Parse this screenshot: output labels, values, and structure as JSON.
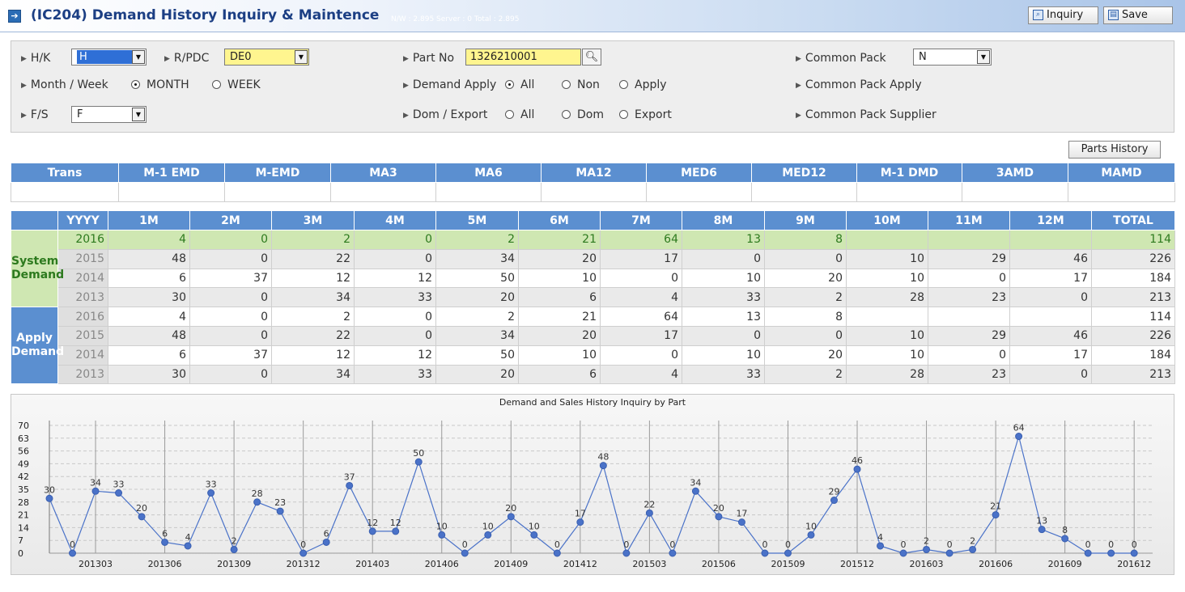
{
  "header": {
    "title": "(IC204) Demand History Inquiry & Maintence",
    "stats": "N/W : 2.895   Server : 0   Total : 2.895",
    "inquiry_label": "Inquiry",
    "save_label": "Save"
  },
  "filters": {
    "hk_label": "H/K",
    "hk_value": "H",
    "rpdc_label": "R/PDC",
    "rpdc_value": "DE0",
    "partno_label": "Part No",
    "partno_value": "1326210001",
    "common_pack_label": "Common Pack",
    "common_pack_value": "N",
    "month_week_label": "Month / Week",
    "month_option": "MONTH",
    "week_option": "WEEK",
    "month_week_selected": "MONTH",
    "demand_apply_label": "Demand Apply",
    "demand_apply_options": [
      "All",
      "Non",
      "Apply"
    ],
    "demand_apply_selected": "All",
    "common_pack_apply_label": "Common Pack Apply",
    "fs_label": "F/S",
    "fs_value": "F",
    "dom_export_label": "Dom / Export",
    "dom_export_options": [
      "All",
      "Dom",
      "Export"
    ],
    "dom_export_selected": "",
    "common_pack_supplier_label": "Common Pack Supplier"
  },
  "parts_history_label": "Parts History",
  "trans_table": {
    "headers": [
      "Trans",
      "M-1 EMD",
      "M-EMD",
      "MA3",
      "MA6",
      "MA12",
      "MED6",
      "MED12",
      "M-1 DMD",
      "3AMD",
      "MAMD"
    ],
    "row": [
      "",
      "",
      "",
      "",
      "",
      "",
      "",
      "",
      "",
      "",
      ""
    ]
  },
  "history_table": {
    "headers": [
      "YYYY",
      "1M",
      "2M",
      "3M",
      "4M",
      "5M",
      "6M",
      "7M",
      "8M",
      "9M",
      "10M",
      "11M",
      "12M",
      "TOTAL"
    ],
    "groups": [
      {
        "label_line1": "System",
        "label_line2": "Demand",
        "rows": [
          {
            "year": "2016",
            "values": [
              "4",
              "0",
              "2",
              "0",
              "2",
              "21",
              "64",
              "13",
              "8",
              "",
              "",
              ""
            ],
            "total": "114"
          },
          {
            "year": "2015",
            "values": [
              "48",
              "0",
              "22",
              "0",
              "34",
              "20",
              "17",
              "0",
              "0",
              "10",
              "29",
              "46"
            ],
            "total": "226"
          },
          {
            "year": "2014",
            "values": [
              "6",
              "37",
              "12",
              "12",
              "50",
              "10",
              "0",
              "10",
              "20",
              "10",
              "0",
              "17"
            ],
            "total": "184"
          },
          {
            "year": "2013",
            "values": [
              "30",
              "0",
              "34",
              "33",
              "20",
              "6",
              "4",
              "33",
              "2",
              "28",
              "23",
              "0"
            ],
            "total": "213"
          }
        ]
      },
      {
        "label_line1": "Apply",
        "label_line2": "Demand",
        "rows": [
          {
            "year": "2016",
            "values": [
              "4",
              "0",
              "2",
              "0",
              "2",
              "21",
              "64",
              "13",
              "8",
              "",
              "",
              ""
            ],
            "total": "114"
          },
          {
            "year": "2015",
            "values": [
              "48",
              "0",
              "22",
              "0",
              "34",
              "20",
              "17",
              "0",
              "0",
              "10",
              "29",
              "46"
            ],
            "total": "226"
          },
          {
            "year": "2014",
            "values": [
              "6",
              "37",
              "12",
              "12",
              "50",
              "10",
              "0",
              "10",
              "20",
              "10",
              "0",
              "17"
            ],
            "total": "184"
          },
          {
            "year": "2013",
            "values": [
              "30",
              "0",
              "34",
              "33",
              "20",
              "6",
              "4",
              "33",
              "2",
              "28",
              "23",
              "0"
            ],
            "total": "213"
          }
        ]
      }
    ]
  },
  "chart_data": {
    "type": "line",
    "title": "Demand and Sales History Inquiry by Part",
    "xlabel": "",
    "ylabel": "",
    "ylim": [
      0,
      70
    ],
    "yticks": [
      0,
      7,
      14,
      21,
      28,
      35,
      42,
      49,
      56,
      63,
      70
    ],
    "grid": true,
    "x": [
      "201301",
      "201302",
      "201303",
      "201304",
      "201305",
      "201306",
      "201307",
      "201308",
      "201309",
      "201310",
      "201311",
      "201312",
      "201401",
      "201402",
      "201403",
      "201404",
      "201405",
      "201406",
      "201407",
      "201408",
      "201409",
      "201410",
      "201411",
      "201412",
      "201501",
      "201502",
      "201503",
      "201504",
      "201505",
      "201506",
      "201507",
      "201508",
      "201509",
      "201510",
      "201511",
      "201512",
      "201601",
      "201602",
      "201603",
      "201604",
      "201605",
      "201606",
      "201607",
      "201608",
      "201609",
      "201610",
      "201611",
      "201612"
    ],
    "x_tick_labels": [
      "201303",
      "201306",
      "201309",
      "201312",
      "201403",
      "201406",
      "201409",
      "201412",
      "201503",
      "201506",
      "201509",
      "201512",
      "201603",
      "201606",
      "201609",
      "201612"
    ],
    "series": [
      {
        "name": "",
        "color": "#4a72c8",
        "values": [
          30,
          0,
          34,
          33,
          20,
          6,
          4,
          33,
          2,
          28,
          23,
          0,
          6,
          37,
          12,
          12,
          50,
          10,
          0,
          10,
          20,
          10,
          0,
          17,
          48,
          0,
          22,
          0,
          34,
          20,
          17,
          0,
          0,
          10,
          29,
          46,
          4,
          0,
          2,
          0,
          2,
          21,
          64,
          13,
          8,
          0,
          0,
          0
        ]
      }
    ]
  },
  "colors": {
    "header_blue": "#5b8fd0",
    "highlight_green": "#cfe7b2",
    "input_yellow": "#fff58f",
    "series_blue": "#4a72c8"
  }
}
